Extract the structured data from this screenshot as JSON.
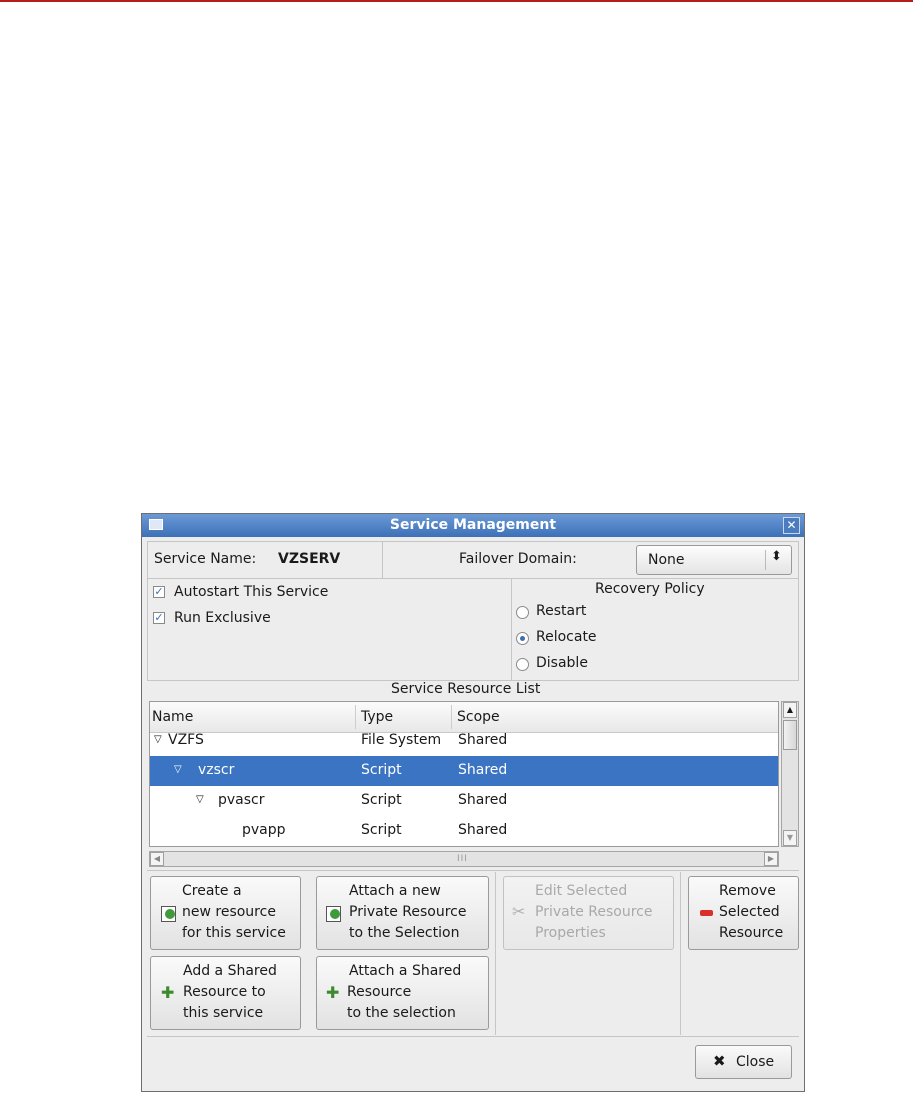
{
  "window": {
    "title": "Service Management",
    "close_glyph": "✕"
  },
  "service": {
    "name_label": "Service Name:",
    "name_value": "VZSERV"
  },
  "failover": {
    "label": "Failover Domain:",
    "value": "None"
  },
  "options": {
    "autostart": {
      "label": "Autostart This Service",
      "checked": true
    },
    "exclusive": {
      "label": "Run Exclusive",
      "checked": true
    }
  },
  "recovery": {
    "title": "Recovery Policy",
    "options": [
      {
        "label": "Restart",
        "selected": false
      },
      {
        "label": "Relocate",
        "selected": true
      },
      {
        "label": "Disable",
        "selected": false
      }
    ]
  },
  "resource_list": {
    "title": "Service Resource List",
    "columns": [
      "Name",
      "Type",
      "Scope"
    ],
    "rows": [
      {
        "name": "VZFS",
        "type": "File System",
        "scope": "Shared",
        "expanded": true,
        "selected": false
      },
      {
        "name": "vzscr",
        "type": "Script",
        "scope": "Shared",
        "expanded": true,
        "selected": true
      },
      {
        "name": "pvascr",
        "type": "Script",
        "scope": "Shared",
        "expanded": true,
        "selected": false
      },
      {
        "name": "pvapp",
        "type": "Script",
        "scope": "Shared",
        "expanded": false,
        "selected": false
      }
    ]
  },
  "buttons": {
    "create_new": [
      "Create a",
      "new resource",
      "for this service"
    ],
    "attach_private": [
      "Attach a new",
      "Private Resource",
      "to the Selection"
    ],
    "edit_selected": [
      "Edit Selected",
      "Private Resource",
      "Properties"
    ],
    "remove_selected": [
      "Remove",
      "Selected",
      "Resource"
    ],
    "add_shared": [
      "Add a Shared",
      "Resource to",
      "this service"
    ],
    "attach_shared": [
      "Attach a Shared",
      "Resource",
      "to the selection"
    ],
    "close": "Close"
  },
  "icons": {
    "new_resource": "new-resource-icon",
    "add": "green-plus-icon",
    "edit": "tools-icon",
    "remove": "red-minus-icon",
    "close": "close-x-icon"
  }
}
